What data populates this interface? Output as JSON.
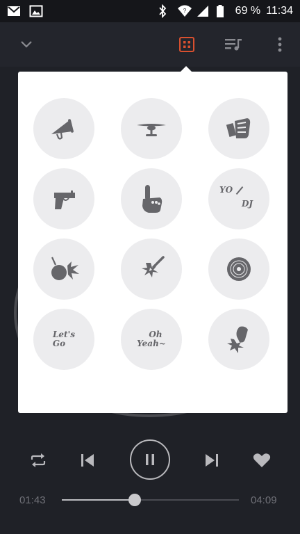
{
  "status": {
    "battery_percent": "69 %",
    "time": "11:34"
  },
  "toolbar": {
    "accent_color": "#d9502f"
  },
  "pads": [
    {
      "name": "megaphone",
      "label": ""
    },
    {
      "name": "airplane",
      "label": ""
    },
    {
      "name": "punch",
      "label": ""
    },
    {
      "name": "gun",
      "label": ""
    },
    {
      "name": "hand-point",
      "label": ""
    },
    {
      "name": "yo-dj",
      "label": "YO/DJ"
    },
    {
      "name": "bomb",
      "label": ""
    },
    {
      "name": "spark-hit",
      "label": ""
    },
    {
      "name": "vinyl-disc",
      "label": ""
    },
    {
      "name": "lets-go",
      "label": "Let's Go"
    },
    {
      "name": "oh-yeah",
      "label": "Oh Yeah~"
    },
    {
      "name": "hand-slap",
      "label": ""
    }
  ],
  "pad_labels": {
    "yo": "YO",
    "dj": "DJ",
    "lets": "Let's",
    "go": "Go",
    "oh": "Oh",
    "yeah": "Yeah~"
  },
  "player": {
    "elapsed": "01:43",
    "duration": "04:09",
    "progress": 0.41,
    "state": "playing"
  }
}
